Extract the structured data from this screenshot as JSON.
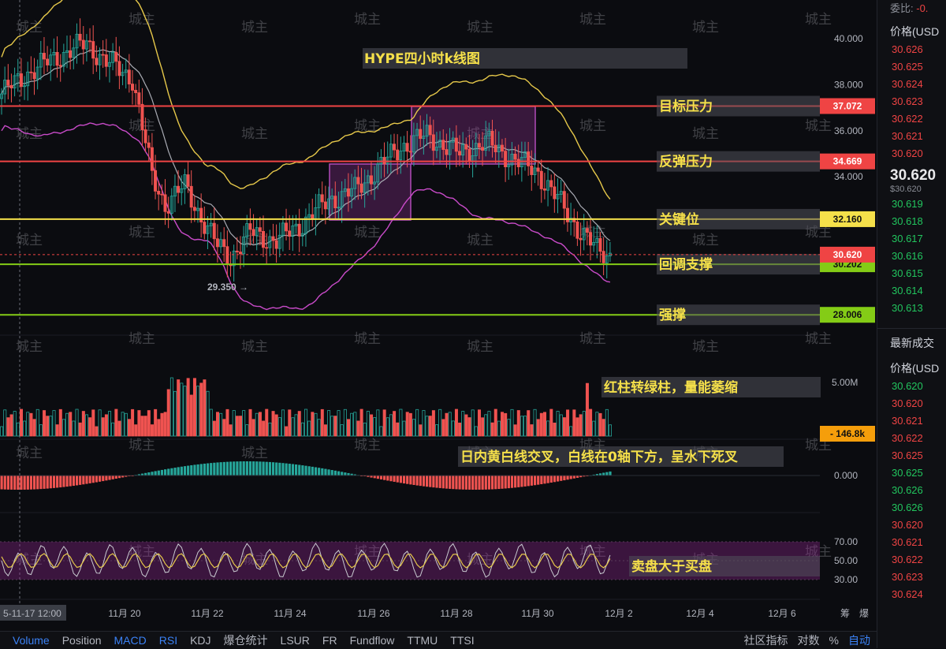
{
  "chart_data": {
    "type": "candlestick",
    "title": "HYPE四小时k线图",
    "price_axis": {
      "ticks": [
        "40.000",
        "38.000",
        "36.000",
        "34.000"
      ],
      "ylim": [
        27.5,
        41.5
      ]
    },
    "x_axis": {
      "current_label": "5-11-17 12:00",
      "ticks": [
        "11月 20",
        "11月 22",
        "11月 24",
        "11月 26",
        "11月 28",
        "11月 30",
        "12月 2",
        "12月 4",
        "12月 6"
      ]
    },
    "levels": [
      {
        "name": "目标压力",
        "value": "37.072",
        "color": "#ef4444"
      },
      {
        "name": "反弹压力",
        "value": "34.669",
        "color": "#ef4444"
      },
      {
        "name": "关键位",
        "value": "32.160",
        "color": "#f5e04a"
      },
      {
        "name": "回调支撑",
        "value": "30.202",
        "color": "#84cc16"
      },
      {
        "name": "强撑",
        "value": "28.006",
        "color": "#84cc16"
      }
    ],
    "current_price": "30.620",
    "low_marker": "29.350",
    "volume": {
      "axis_label": "5.00M",
      "current": "146.8k",
      "note": "红柱转绿柱，量能萎缩"
    },
    "macd": {
      "axis_label": "0.000",
      "note": "日内黄白线交叉，白线在0轴下方，呈水下死叉"
    },
    "rsi": {
      "ticks": [
        "70.00",
        "50.00",
        "30.00"
      ],
      "note": "卖盘大于买盘"
    },
    "watermark": "城主",
    "colors": {
      "up": "#26a69a",
      "down": "#ef5350",
      "bg": "#0b0c10"
    }
  },
  "toolbar": {
    "tabs": [
      "Volume",
      "Position",
      "MACD",
      "RSI",
      "KDJ",
      "爆仓统计",
      "LSUR",
      "FR",
      "Fundflow",
      "TTMU",
      "TTSI"
    ],
    "active": [
      "Volume",
      "MACD",
      "RSI"
    ],
    "right": [
      "社区指标",
      "对数",
      "%",
      "自动"
    ]
  },
  "corner": [
    "筹",
    "爆"
  ],
  "orderbook": {
    "top_label": "委比:",
    "top_value": "-0.",
    "header_price": "价格(USD",
    "asks": [
      "30.626",
      "30.625",
      "30.624",
      "30.623",
      "30.622",
      "30.621",
      "30.620"
    ],
    "mid_price": "30.620",
    "mid_sub": "$30.620",
    "bids": [
      "30.619",
      "30.618",
      "30.617",
      "30.616",
      "30.615",
      "30.614",
      "30.613"
    ],
    "trades_title": "最新成交",
    "trades_header": "价格(USD",
    "trades": [
      {
        "p": "30.620",
        "c": "green"
      },
      {
        "p": "30.620",
        "c": "red"
      },
      {
        "p": "30.621",
        "c": "red"
      },
      {
        "p": "30.622",
        "c": "red"
      },
      {
        "p": "30.625",
        "c": "red"
      },
      {
        "p": "30.625",
        "c": "green"
      },
      {
        "p": "30.626",
        "c": "green"
      },
      {
        "p": "30.626",
        "c": "green"
      },
      {
        "p": "30.620",
        "c": "red"
      },
      {
        "p": "30.621",
        "c": "red"
      },
      {
        "p": "30.622",
        "c": "red"
      },
      {
        "p": "30.623",
        "c": "red"
      },
      {
        "p": "30.624",
        "c": "red"
      }
    ]
  }
}
